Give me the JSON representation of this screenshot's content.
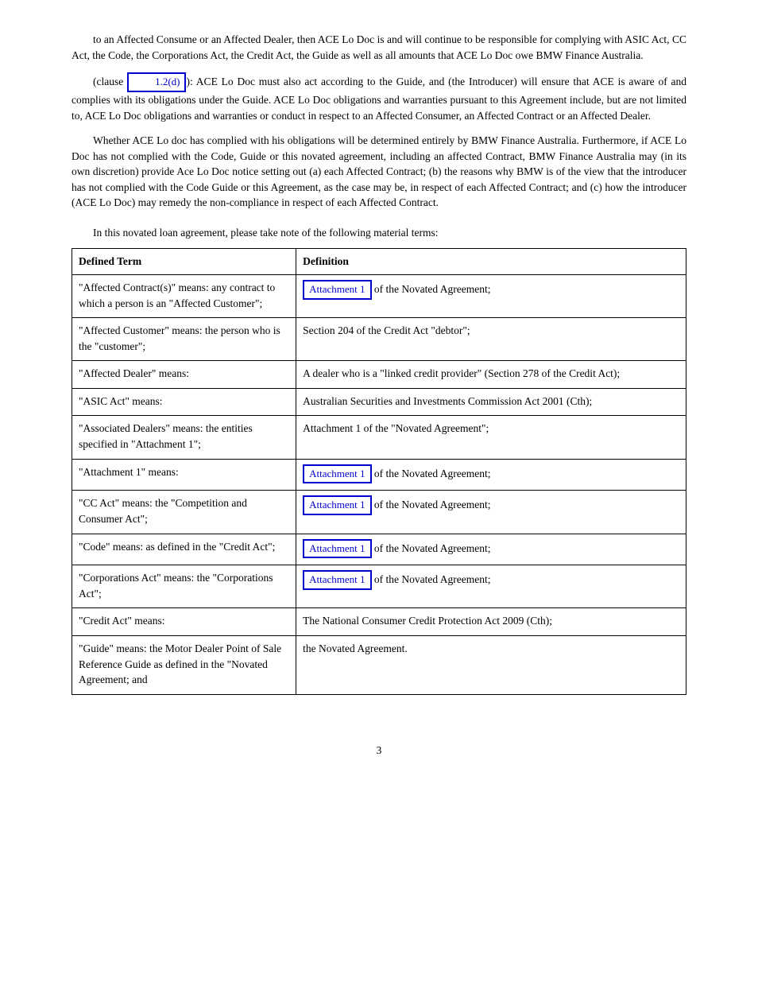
{
  "para1": "to an Affected Consume or an Affected Dealer, then ACE Lo Doc is and will continue to be responsible for complying with ASIC Act, CC Act, the Code, the Corporations Act, the Credit Act, the Guide as well as all amounts that ACE Lo Doc owe BMW Finance Australia.",
  "para2": {
    "before": "(clause ",
    "link_text": "1.2(d)",
    "after": "): ACE Lo Doc must also act according to the Guide, and (the Introducer) will ensure that ACE is aware of and complies with its obligations under the Guide. ACE Lo Doc obligations and warranties pursuant to this Agreement include, but are not limited to, ACE Lo Doc obligations and warranties or conduct in respect to an Affected Consumer, an Affected Contract or an Affected Dealer."
  },
  "para3": "Whether ACE Lo doc has complied with his obligations will be determined entirely by BMW Finance Australia. Furthermore, if ACE Lo Doc has not complied with the Code, Guide or this novated agreement, including an affected Contract, BMW Finance Australia may (in its own discretion) provide Ace Lo Doc notice setting out (a) each Affected Contract; (b) the reasons why BMW is of the view that the introducer has not complied with the Code Guide or this Agreement, as the case may be, in respect of each Affected Contract; and (c) how the introducer (ACE Lo Doc) may remedy the non-compliance in respect of each Affected Contract.",
  "para4": "In this novated loan agreement, please take note of the following material terms:",
  "table": {
    "headers": {
      "col1": "Defined Term",
      "col2": "Definition"
    },
    "rows": [
      {
        "left": "\"Affected Contract(s)\" means: any contract to which a person is an \"Affected Customer\";",
        "right_link": "Attachment 1",
        "right_text": " of the Novated Agreement;"
      },
      {
        "left": "\"Affected Customer\" means: the person who is the \"customer\";",
        "right_plain": "Section 204 of the Credit Act \"debtor\";"
      },
      {
        "left": "\"Affected Dealer\" means:",
        "right_plain": "A dealer who is a \"linked credit provider\" (Section 278 of the Credit Act);"
      },
      {
        "left": "\"ASIC Act\" means:",
        "right_plain": "Australian Securities and Investments Commission Act 2001 (Cth);"
      },
      {
        "left": "\"Associated Dealers\" means: the entities specified in \"Attachment 1\";",
        "right_plain": "Attachment 1 of the \"Novated Agreement\";"
      },
      {
        "left": "\"Attachment 1\" means:",
        "right_link": "Attachment 1",
        "right_text": " of the Novated Agreement;"
      },
      {
        "left": "\"CC Act\" means: the \"Competition and Consumer Act\";",
        "right_link": "Attachment 1",
        "right_text": " of the Novated Agreement;"
      },
      {
        "left": "\"Code\" means: as defined in the \"Credit Act\";",
        "right_link": "Attachment 1",
        "right_text": " of the Novated Agreement;"
      },
      {
        "left": "\"Corporations Act\" means: the \"Corporations Act\";",
        "right_link": "Attachment 1",
        "right_text": " of the Novated Agreement;"
      },
      {
        "left": "\"Credit Act\" means:",
        "right_plain": "The National Consumer Credit Protection Act 2009 (Cth);"
      },
      {
        "left": "\"Guide\" means: the Motor Dealer Point of Sale Reference Guide as defined in the \"Novated Agreement; and",
        "right_plain": "the Novated Agreement."
      }
    ]
  },
  "page_number": "3"
}
